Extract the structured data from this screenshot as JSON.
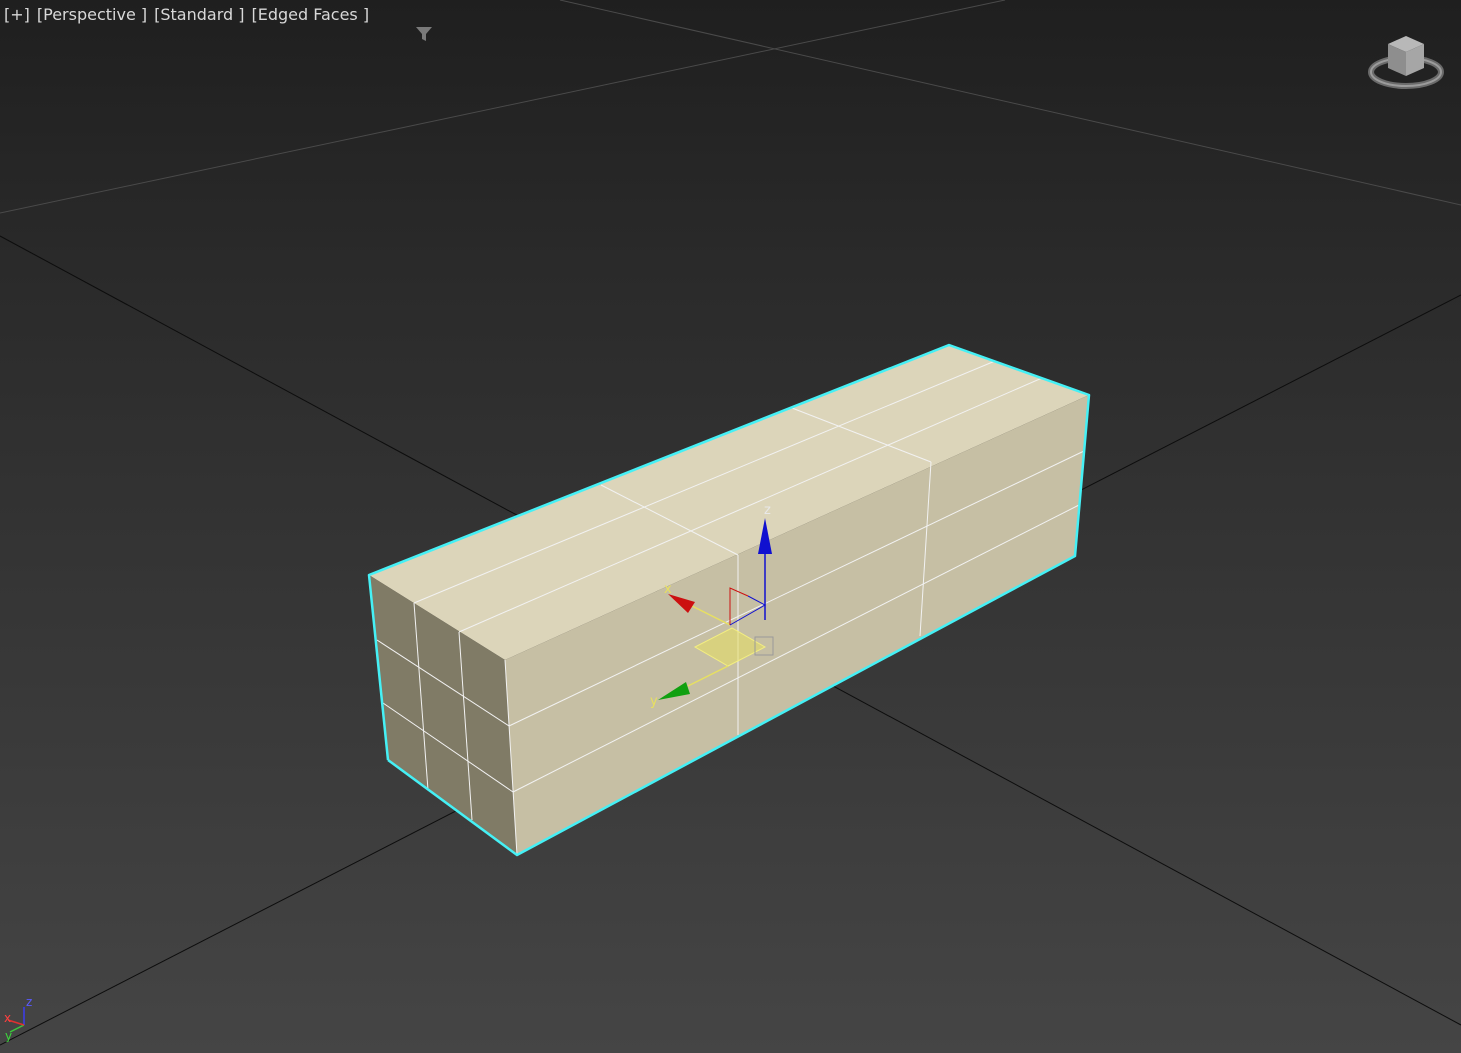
{
  "viewport": {
    "label": {
      "plus": "[+]",
      "view": "[Perspective ]",
      "shading": "[Standard ]",
      "display": "[Edged Faces ]"
    },
    "filter_icon": "filter-funnel-icon"
  },
  "gizmo": {
    "x_label": "x",
    "y_label": "y",
    "z_label": "z",
    "colors": {
      "x": "#cc1010",
      "y": "#10a010",
      "z": "#1010d0",
      "plane": "#e8e060",
      "selection": "#45f0f5"
    }
  },
  "axis_tripod": {
    "x_label": "x",
    "y_label": "y",
    "z_label": "z"
  },
  "colors": {
    "box_top": "#dcd5ba",
    "box_front": "#c6bfa4",
    "box_side": "#807b66",
    "grid_line": "#0d0d0d",
    "wire": "#f2f2f2"
  },
  "viewcube": {
    "icon": "viewcube-icon"
  }
}
